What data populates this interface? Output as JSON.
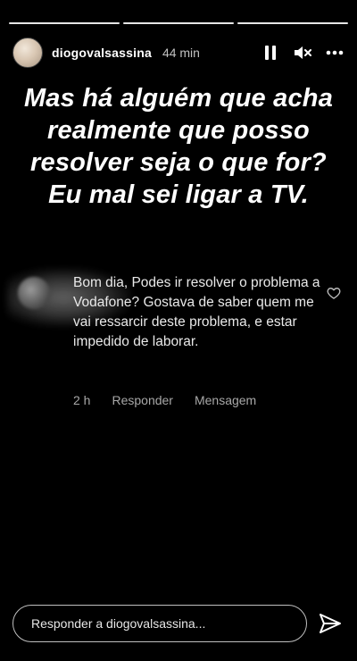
{
  "story": {
    "progress_segments": 3,
    "user": {
      "username": "diogovalsassina",
      "time_ago": "44 min"
    },
    "icons": {
      "pause": "pause-icon",
      "mute": "mute-icon",
      "more": "more-icon",
      "heart": "heart-icon",
      "send": "send-icon"
    },
    "headline": "Mas há alguém que acha realmente que posso resolver seja o que for? Eu mal sei ligar a TV.",
    "comment": {
      "text": "Bom dia, Podes ir resolver o problema a Vodafone? Gostava de saber quem me vai ressarcir deste problema, e estar impedido de laborar.",
      "time": "2 h",
      "reply_label": "Responder",
      "message_label": "Mensagem"
    },
    "reply_placeholder": "Responder a diogovalsassina..."
  }
}
